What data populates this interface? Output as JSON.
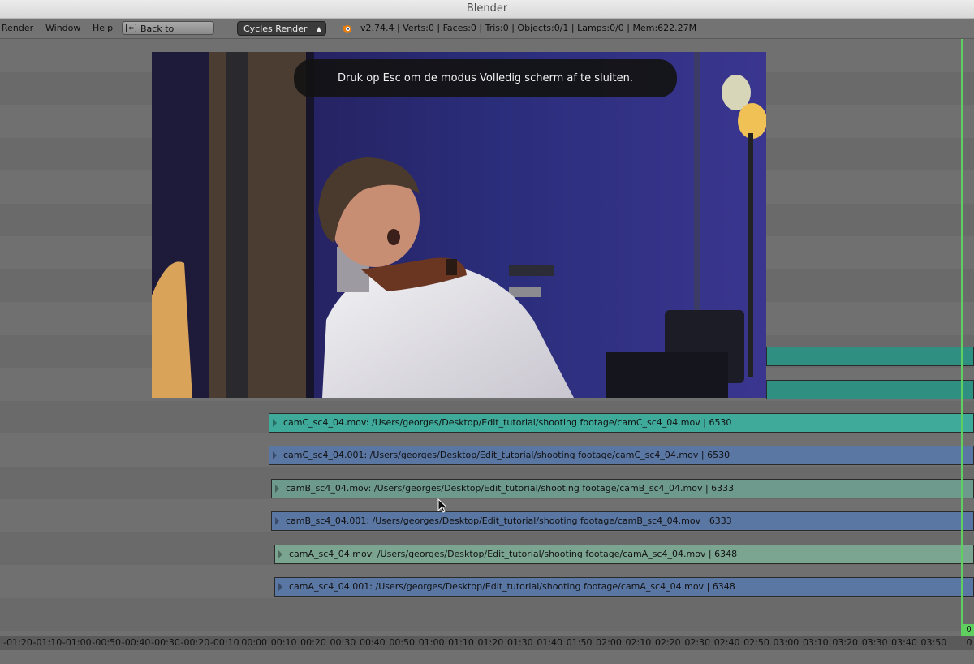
{
  "window": {
    "title": "Blender"
  },
  "menu": {
    "items": [
      "Render",
      "Window",
      "Help"
    ],
    "back_button": "Back to Previous",
    "render_engine": "Cycles Render",
    "stats": "v2.74.4 | Verts:0 | Faces:0 | Tris:0 | Objects:0/1 | Lamps:0/0 | Mem:622.27M"
  },
  "fullscreen_notice": "Druk op Esc om de modus Volledig scherm af te sluiten.",
  "strips": [
    {
      "label": "camC_sc4_04.mov: /Users/georges/Desktop/Edit_tutorial/shooting footage/camC_sc4_04.mov | 6530",
      "kind": "movie",
      "color": "#3fa99a"
    },
    {
      "label": "camC_sc4_04.001: /Users/georges/Desktop/Edit_tutorial/shooting footage/camC_sc4_04.mov | 6530",
      "kind": "sound",
      "color": "#5a76a3"
    },
    {
      "label": "camB_sc4_04.mov: /Users/georges/Desktop/Edit_tutorial/shooting footage/camB_sc4_04.mov | 6333",
      "kind": "movie",
      "color": "#6e9a8e"
    },
    {
      "label": "camB_sc4_04.001: /Users/georges/Desktop/Edit_tutorial/shooting footage/camB_sc4_04.mov | 6333",
      "kind": "sound",
      "color": "#5a76a3"
    },
    {
      "label": "camA_sc4_04.mov: /Users/georges/Desktop/Edit_tutorial/shooting footage/camA_sc4_04.mov | 6348",
      "kind": "movie",
      "color": "#7ba590"
    },
    {
      "label": "camA_sc4_04.001: /Users/georges/Desktop/Edit_tutorial/shooting footage/camA_sc4_04.mov | 6348",
      "kind": "sound",
      "color": "#5a76a3"
    }
  ],
  "timeline": {
    "ticks": [
      "-01:20",
      "-01:10",
      "-01:00",
      "-00:50",
      "-00:40",
      "-00:30",
      "-00:20",
      "-00:10",
      "00:00",
      "00:10",
      "00:20",
      "00:30",
      "00:40",
      "00:50",
      "01:00",
      "01:10",
      "01:20",
      "01:30",
      "01:40",
      "01:50",
      "02:00",
      "02:10",
      "02:20",
      "02:30",
      "02:40",
      "02:50",
      "03:00",
      "03:10",
      "03:20",
      "03:30",
      "03:40",
      "03:50",
      "0"
    ],
    "current_frame": "0"
  }
}
